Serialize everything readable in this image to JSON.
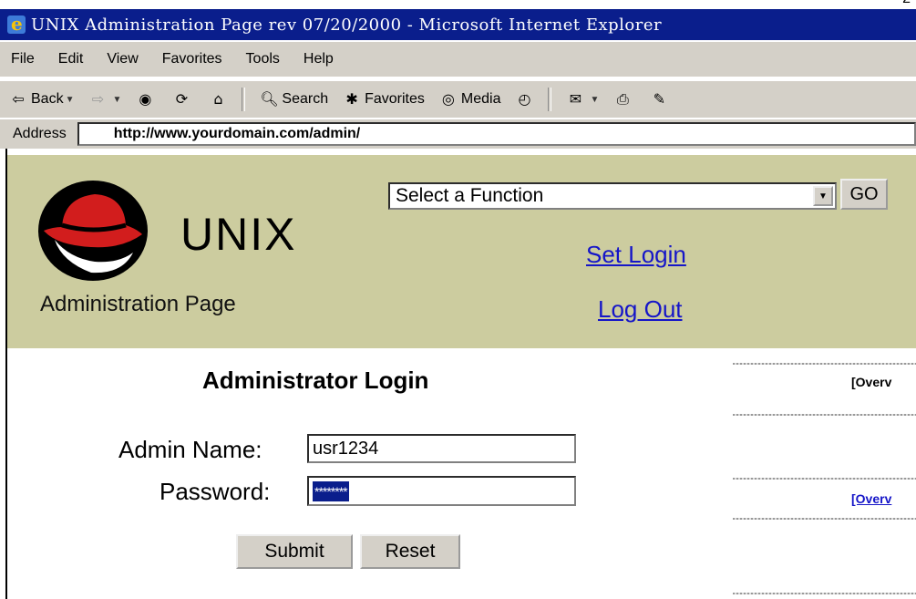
{
  "window": {
    "title": "UNIX Administration Page rev 07/20/2000 - Microsoft Internet Explorer",
    "corner_mark": "2"
  },
  "menu": [
    "File",
    "Edit",
    "View",
    "Favorites",
    "Tools",
    "Help"
  ],
  "toolbar": {
    "back": "Back",
    "search": "Search",
    "favorites": "Favorites",
    "media": "Media"
  },
  "address": {
    "label": "Address",
    "url": "http://www.yourdomain.com/admin/"
  },
  "banner": {
    "logo_text": "UNIX",
    "subtitle": "Administration Page",
    "select_value": "Select a Function",
    "go_label": "GO",
    "set_login": "Set Login",
    "log_out": "Log Out"
  },
  "login": {
    "title": "Administrator Login",
    "admin_name_label": "Admin Name:",
    "admin_name_value": "usr1234",
    "password_label": "Password:",
    "password_mask": "********",
    "submit_label": "Submit",
    "reset_label": "Reset"
  },
  "right_panel": {
    "overview_1": "[Overv",
    "overview_2": "[Overv"
  }
}
